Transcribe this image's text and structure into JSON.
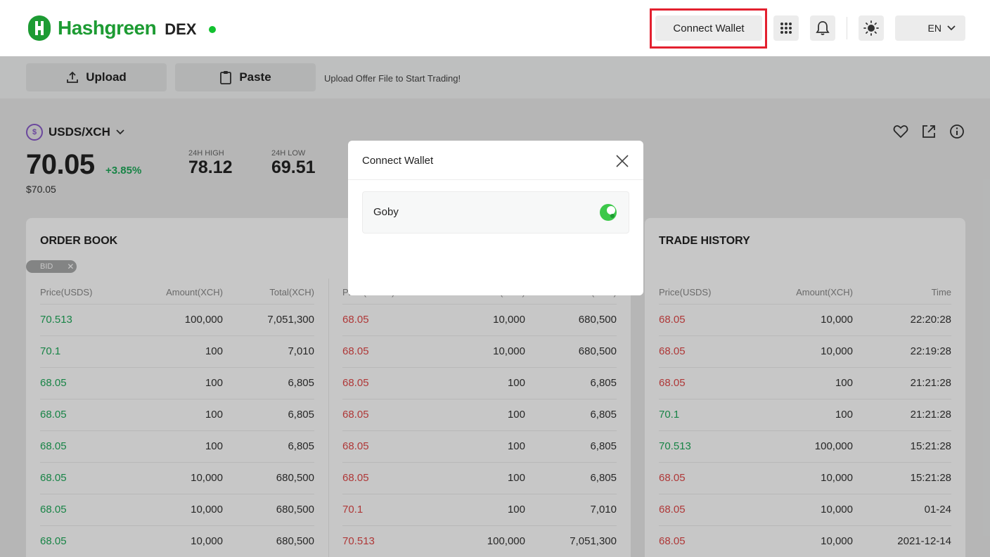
{
  "header": {
    "logo_text": "Hashgreen",
    "logo_sub": "DEX",
    "connect_wallet_label": "Connect Wallet",
    "language": "EN"
  },
  "toolbar": {
    "upload_label": "Upload",
    "paste_label": "Paste",
    "hint": "Upload Offer File to Start Trading!"
  },
  "pair": {
    "name": "USDS/XCH",
    "icon_symbol": "$",
    "price": "70.05",
    "change": "+3.85%",
    "price_usd": "$70.05",
    "high_label": "24H HIGH",
    "high_value": "78.12",
    "low_label": "24H LOW",
    "low_value": "69.51"
  },
  "order_book": {
    "title": "ORDER BOOK",
    "tag": "BID",
    "columns": [
      "Price(USDS)",
      "Amount(XCH)",
      "Total(XCH)"
    ],
    "bids": [
      [
        "70.513",
        "100,000",
        "7,051,300"
      ],
      [
        "70.1",
        "100",
        "7,010"
      ],
      [
        "68.05",
        "100",
        "6,805"
      ],
      [
        "68.05",
        "100",
        "6,805"
      ],
      [
        "68.05",
        "100",
        "6,805"
      ],
      [
        "68.05",
        "10,000",
        "680,500"
      ],
      [
        "68.05",
        "10,000",
        "680,500"
      ],
      [
        "68.05",
        "10,000",
        "680,500"
      ]
    ],
    "asks": [
      [
        "68.05",
        "10,000",
        "680,500"
      ],
      [
        "68.05",
        "10,000",
        "680,500"
      ],
      [
        "68.05",
        "100",
        "6,805"
      ],
      [
        "68.05",
        "100",
        "6,805"
      ],
      [
        "68.05",
        "100",
        "6,805"
      ],
      [
        "68.05",
        "100",
        "6,805"
      ],
      [
        "70.1",
        "100",
        "7,010"
      ],
      [
        "70.513",
        "100,000",
        "7,051,300"
      ]
    ]
  },
  "trade_history": {
    "title": "TRADE HISTORY",
    "columns": [
      "Price(USDS)",
      "Amount(XCH)",
      "Time"
    ],
    "rows": [
      [
        "68.05",
        "10,000",
        "22:20:28",
        "red"
      ],
      [
        "68.05",
        "10,000",
        "22:19:28",
        "red"
      ],
      [
        "68.05",
        "100",
        "21:21:28",
        "red"
      ],
      [
        "70.1",
        "100",
        "21:21:28",
        "green"
      ],
      [
        "70.513",
        "100,000",
        "15:21:28",
        "green"
      ],
      [
        "68.05",
        "10,000",
        "15:21:28",
        "red"
      ],
      [
        "68.05",
        "10,000",
        "01-24",
        "red"
      ],
      [
        "68.05",
        "10,000",
        "2021-12-14",
        "red"
      ]
    ]
  },
  "modal": {
    "title": "Connect Wallet",
    "wallet_name": "Goby"
  },
  "colors": {
    "brand": "#1d9b33",
    "buy": "#1fa95a",
    "sell": "#e04848",
    "highlight": "#e3202f"
  }
}
